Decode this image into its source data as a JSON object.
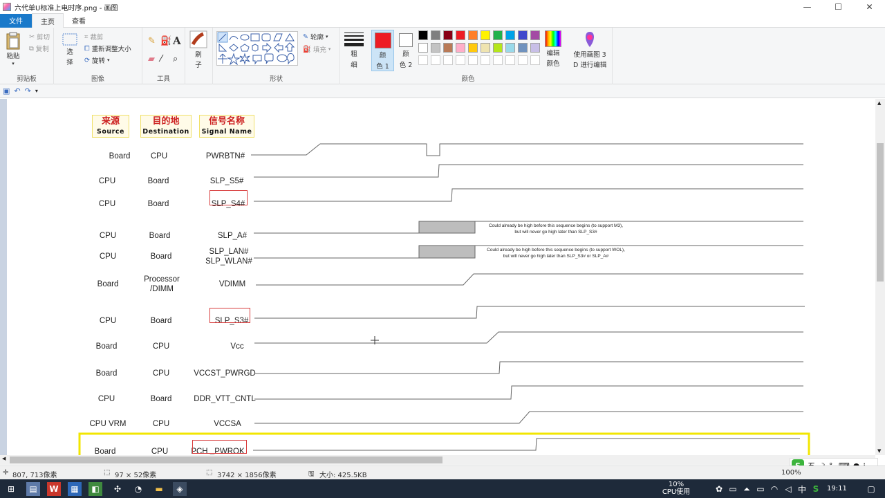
{
  "window": {
    "title": "六代单U标准上电时序.png - 画图",
    "controls": {
      "minimize": "—",
      "maximize": "☐",
      "close": "✕"
    }
  },
  "tabs": [
    {
      "label": "文件"
    },
    {
      "label": "主页"
    },
    {
      "label": "查看"
    }
  ],
  "ribbon": {
    "clipboard": {
      "paste": "粘贴",
      "cut": "剪切",
      "copy": "复制",
      "group": "剪贴板"
    },
    "image": {
      "select_1": "选",
      "select_2": "择",
      "crop": "裁剪",
      "resize": "重新调整大小",
      "rotate": "旋转",
      "group": "图像"
    },
    "tools": {
      "group": "工具",
      "text_tool": "A"
    },
    "brushes": {
      "label_1": "刷",
      "label_2": "子"
    },
    "shapes": {
      "outline": "轮廓",
      "fill": "填充",
      "group": "形状"
    },
    "size": {
      "label_1": "粗",
      "label_2": "细"
    },
    "color1": {
      "label_1": "颜",
      "label_2": "色 1",
      "value": "#ed1c24"
    },
    "color2": {
      "label_1": "颜",
      "label_2": "色 2",
      "value": "#ffffff"
    },
    "colors": {
      "group": "颜色",
      "row1": [
        "#000000",
        "#7f7f7f",
        "#880015",
        "#ed1c24",
        "#ff7f27",
        "#fff200",
        "#22b14c",
        "#00a2e8",
        "#3f48cc",
        "#a349a4"
      ],
      "row2": [
        "#ffffff",
        "#c3c3c3",
        "#b97a57",
        "#ffaec9",
        "#ffc90e",
        "#efe4b0",
        "#b5e61d",
        "#99d9ea",
        "#7092be",
        "#c8bfe7"
      ],
      "row3": [
        "#ffffff",
        "#ffffff",
        "#ffffff",
        "#ffffff",
        "#ffffff",
        "#ffffff",
        "#ffffff",
        "#ffffff",
        "#ffffff",
        "#ffffff"
      ]
    },
    "edit_colors": {
      "label_1": "编辑",
      "label_2": "颜色"
    },
    "paint3d": {
      "label_1": "使用画图 3",
      "label_2": "D 进行编辑"
    }
  },
  "diagram": {
    "headers": [
      {
        "cn": "来源",
        "en": "Source"
      },
      {
        "cn": "目的地",
        "en": "Destination"
      },
      {
        "cn": "信号名称",
        "en": "Signal Name"
      }
    ],
    "rows": [
      {
        "source": "Board",
        "dest": "CPU",
        "signal": "PWRBTN#"
      },
      {
        "source": "CPU",
        "dest": "Board",
        "signal": "SLP_S5#"
      },
      {
        "source": "CPU",
        "dest": "Board",
        "signal": "SLP_S4#"
      },
      {
        "source": "CPU",
        "dest": "Board",
        "signal": "SLP_A#"
      },
      {
        "source": "CPU",
        "dest": "Board",
        "signal": "SLP_LAN#",
        "signal2": "SLP_WLAN#"
      },
      {
        "source": "Board",
        "dest": "Processor",
        "dest2": "/DIMM",
        "signal": "VDIMM"
      },
      {
        "source": "CPU",
        "dest": "Board",
        "signal": "SLP_S3#"
      },
      {
        "source": "Board",
        "dest": "CPU",
        "signal": "Vcc"
      },
      {
        "source": "Board",
        "dest": "CPU",
        "signal": "VCCST_PWRGD"
      },
      {
        "source": "CPU",
        "dest": "Board",
        "signal": "DDR_VTT_CNTL"
      },
      {
        "source": "CPU VRM",
        "dest": "CPU",
        "signal": "VCCSA"
      },
      {
        "source": "Board",
        "dest": "CPU",
        "signal": "PCH _PWROK"
      }
    ],
    "notes": [
      {
        "line1": "Could already be high before this sequence begins (to support M3),",
        "line2": "but will never go high later than SLP_S3#"
      },
      {
        "line1": "Could already be high before this sequence begins (to support WOL),",
        "line2": "but will never go high later than SLP_S3# or SLP_A#"
      }
    ]
  },
  "status": {
    "cursor": "807, 713像素",
    "selection": "97 × 52像素",
    "image_size": "3742 × 1856像素",
    "file_size": "大小: 425.5KB",
    "zoom": "100%"
  },
  "ime": {
    "mode": "五",
    "punct": "°,"
  },
  "taskbar": {
    "cpu_pct": "10%",
    "cpu_label": "CPU使用",
    "lang": "中",
    "time": "19:11"
  }
}
